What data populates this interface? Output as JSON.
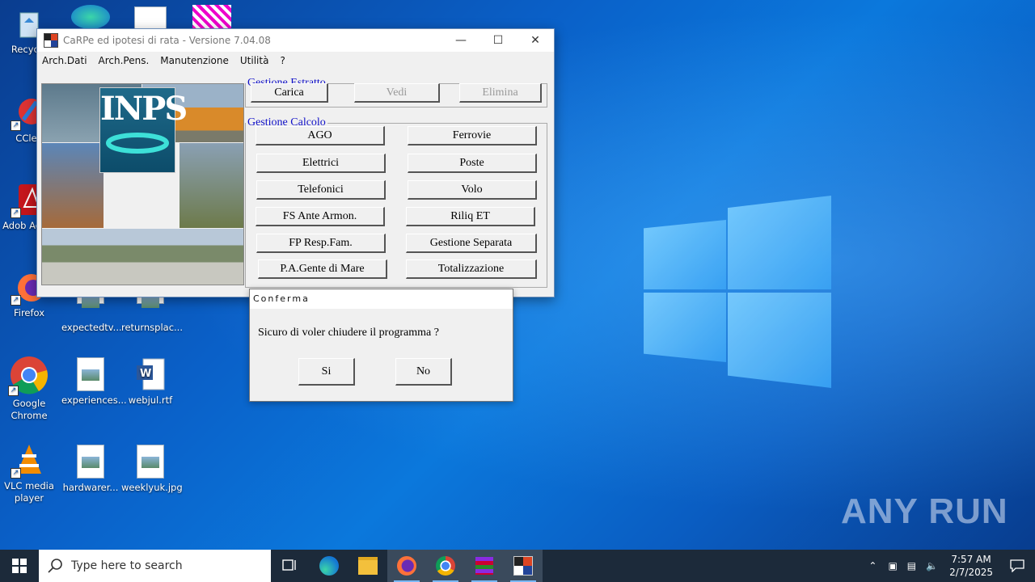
{
  "desktop": {
    "icons": [
      {
        "label": "Recycle",
        "icon": "recycle-bin-icon"
      },
      {
        "label": "CClea",
        "icon": "ccleaner-icon"
      },
      {
        "label": "Adob Acrob",
        "icon": "adobe-acrobat-icon"
      },
      {
        "label": "Firefox",
        "icon": "firefox-icon"
      },
      {
        "label": "expectedtv...",
        "icon": "image-file-icon"
      },
      {
        "label": "returnsplac...",
        "icon": "image-file-icon"
      },
      {
        "label": "Google Chrome",
        "icon": "chrome-icon"
      },
      {
        "label": "experiences...",
        "icon": "image-file-icon"
      },
      {
        "label": "webjul.rtf",
        "icon": "word-document-icon"
      },
      {
        "label": "VLC media player",
        "icon": "vlc-icon"
      },
      {
        "label": "hardwarer...",
        "icon": "image-file-icon"
      },
      {
        "label": "weeklyuk.jpg",
        "icon": "image-file-icon"
      }
    ],
    "watermark": "ANY RUN"
  },
  "window": {
    "title": "CaRPe ed ipotesi di rata  -  Versione 7.04.08",
    "menu": [
      "Arch.Dati",
      "Arch.Pens.",
      "Manutenzione",
      "Utilità",
      "?"
    ],
    "inps_logo": "INPS",
    "estratto": {
      "legend": "Gestione Estratto",
      "carica": "Carica",
      "vedi": "Vedi",
      "elimina": "Elimina"
    },
    "calcolo": {
      "legend": "Gestione Calcolo",
      "buttons": [
        "AGO",
        "Ferrovie",
        "Elettrici",
        "Poste",
        "Telefonici",
        "Volo",
        "FS Ante Armon.",
        "Riliq ET",
        "FP Resp.Fam.",
        "Gestione Separata",
        "P.A.Gente di Mare",
        "Totalizzazione"
      ]
    }
  },
  "dialog": {
    "title": "Conferma",
    "message": "Sicuro di voler chiudere il programma ?",
    "yes": "Si",
    "no": "No"
  },
  "taskbar": {
    "search_placeholder": "Type here to search",
    "time": "7:57 AM",
    "date": "2/7/2025"
  },
  "colors": {
    "legend": "#1010c8",
    "taskbar": "#1c2a3a",
    "desktop": "#0a60c8"
  }
}
